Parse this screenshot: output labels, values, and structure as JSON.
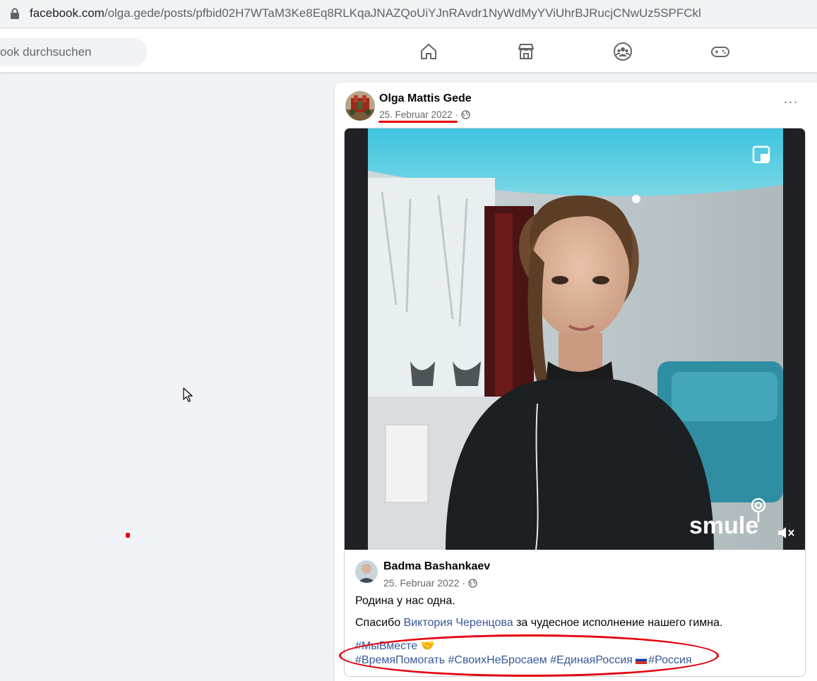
{
  "browser": {
    "url_host": "facebook.com",
    "url_path": "/olga.gede/posts/pfbid02H7WTaM3Ke8Eq8RLKqaJNAZQoUiYJnRAvdr1NyWdMyYViUhrBJRucjCNwUz5SPFCkl"
  },
  "nav": {
    "search_placeholder": "ook durchsuchen",
    "icons": [
      "home-icon",
      "marketplace-icon",
      "groups-icon",
      "gaming-icon"
    ]
  },
  "post": {
    "author": "Olga Mattis Gede",
    "date": "25. Februar 2022",
    "separator": "·",
    "privacy_icon": "globe-icon",
    "more_label": "···",
    "video": {
      "watermark": "smule",
      "pip_icon": "picture-in-picture-icon",
      "mute_icon": "muted-speaker-icon"
    },
    "shared": {
      "author": "Badma Bashankaev",
      "date": "25. Februar 2022",
      "separator": "·",
      "line1": "Родина у нас одна.",
      "line2_prefix": "Спасибо ",
      "line2_link": "Виктория Черенцова",
      "line2_suffix": " за чудесное исполнение нашего гимна.",
      "tag1": "#МыВместе",
      "tag1_emoji": "🤝",
      "tag2": "#ВремяПомогать",
      "tag3": "#СвоихНеБросаем",
      "tag4": "#ЕдинаяРоссия",
      "tag5": "#Россия"
    }
  },
  "colors": {
    "link": "#385898",
    "annotation": "#e3000f",
    "fb_bg": "#f0f2f5"
  }
}
